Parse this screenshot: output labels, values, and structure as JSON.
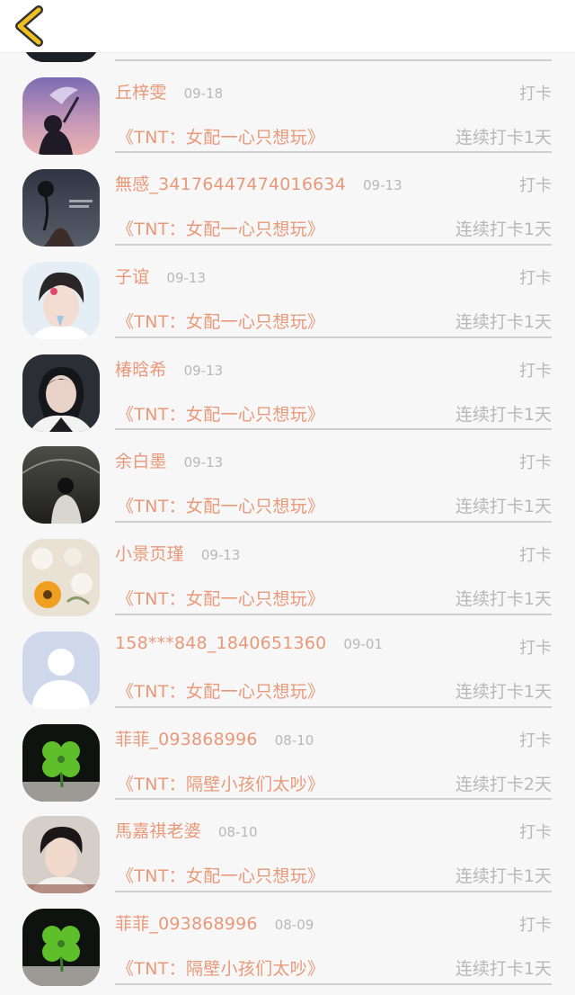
{
  "nav": {
    "back_icon": "chevron-left-icon",
    "accent_color": "#f0c020"
  },
  "colors": {
    "name": "#e8997a",
    "muted": "#b8b8b8",
    "background": "#f7f7f7"
  },
  "rows": [
    {
      "name": "",
      "date": "",
      "type": "",
      "book": "",
      "streak": "",
      "avatar": "avatar-partial"
    },
    {
      "name": "丘梓雯",
      "date": "09-18",
      "type": "打卡",
      "book": "《TNT：女配一心只想玩》",
      "streak": "连续打卡1天",
      "avatar": "avatar-purple-sky"
    },
    {
      "name": "無感_34176447474016634",
      "date": "09-13",
      "type": "打卡",
      "book": "《TNT：女配一心只想玩》",
      "streak": "连续打卡1天",
      "avatar": "avatar-dark-flower"
    },
    {
      "name": "子谊",
      "date": "09-13",
      "type": "打卡",
      "book": "《TNT：女配一心只想玩》",
      "streak": "连续打卡1天",
      "avatar": "avatar-boy-light"
    },
    {
      "name": "椿晗希",
      "date": "09-13",
      "type": "打卡",
      "book": "《TNT：女配一心只想玩》",
      "streak": "连续打卡1天",
      "avatar": "avatar-girl-dark"
    },
    {
      "name": "余白墨",
      "date": "09-13",
      "type": "打卡",
      "book": "《TNT：女配一心只想玩》",
      "streak": "连续打卡1天",
      "avatar": "avatar-rain-scene"
    },
    {
      "name": "小景页瑾",
      "date": "09-13",
      "type": "打卡",
      "book": "《TNT：女配一心只想玩》",
      "streak": "连续打卡1天",
      "avatar": "avatar-flowers"
    },
    {
      "name": "158***848_1840651360",
      "date": "09-01",
      "type": "打卡",
      "book": "《TNT：女配一心只想玩》",
      "streak": "连续打卡1天",
      "avatar": "avatar-default-person"
    },
    {
      "name": "菲菲_093868996",
      "date": "08-10",
      "type": "打卡",
      "book": "《TNT：隔壁小孩们太吵》",
      "streak": "连续打卡2天",
      "avatar": "avatar-clover"
    },
    {
      "name": "馬嘉祺老婆",
      "date": "08-10",
      "type": "打卡",
      "book": "《TNT：女配一心只想玩》",
      "streak": "连续打卡1天",
      "avatar": "avatar-boy-dark"
    },
    {
      "name": "菲菲_093868996",
      "date": "08-09",
      "type": "打卡",
      "book": "《TNT：隔壁小孩们太吵》",
      "streak": "连续打卡1天",
      "avatar": "avatar-clover"
    }
  ]
}
